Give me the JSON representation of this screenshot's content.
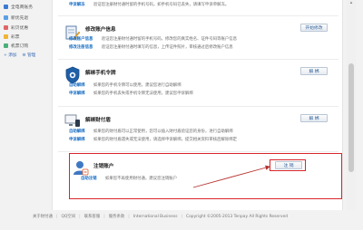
{
  "sidebar": {
    "items": [
      {
        "label": "全电商账务",
        "color": "#3b7bd4"
      },
      {
        "label": "新优先退",
        "color": "#5aa0e6"
      },
      {
        "label": "彩贝优惠",
        "color": "#e06666"
      },
      {
        "label": "彩票",
        "color": "#f2b233"
      },
      {
        "label": "机票订购",
        "color": "#4caf7a"
      }
    ],
    "add_label": "+ 添加",
    "manage_label": "⚙ 管理"
  },
  "sections": [
    {
      "lines": [
        {
          "tag": "申诉解冻",
          "text": "验证您注册财付通时留的手机号码，如手机号码已丢失，请填写申诉单解冻。"
        }
      ]
    },
    {
      "title": "修改账户信息",
      "button": "开始修改",
      "lines": [
        {
          "tag": "修改账户信息",
          "text": "验证您注册财付通时留的手机号码，修改您的真实姓名、证件号码等账户信息"
        },
        {
          "tag": "修改注册信息",
          "text": "验证您注册财付通时填写的信息，上传证件照片，审核通过后修改账户信息"
        }
      ]
    },
    {
      "title": "解绑手机令牌",
      "button": "解 绑",
      "lines": [
        {
          "tag": "自助解绑",
          "text": "如果您的手机令牌可以使用，建议您进行自助解绑"
        },
        {
          "tag": "申诉解绑",
          "text": "如果您的手机丢失或手机令牌无法使用，建议您申诉解绑"
        }
      ]
    },
    {
      "title": "解绑财付盾",
      "button": "解 绑",
      "lines": [
        {
          "tag": "自助解绑",
          "text": "如果您的财付盾可以正常使用，您可以插入财付盾验证您的身份，进行自助解绑"
        },
        {
          "tag": "申诉解绑",
          "text": "如果您的财付盾遗失或无法使用，请选择申诉解绑，提交相关资料审核后解除绑定"
        }
      ]
    },
    {
      "title": "注销账户",
      "button": "注 销",
      "lines": [
        {
          "tag": "自助注销",
          "text": "如果您不再使用财付通，建议您注销账户"
        }
      ]
    }
  ],
  "footer": {
    "links": [
      "关于财付通",
      "QQ空间",
      "联系客服",
      "服务条款",
      "International Business"
    ],
    "copyright": "Copyright ©2005-2013 Tenpay All Rights Reserved"
  },
  "colors": {
    "highlight": "#d8262b",
    "link": "#1a6fc4",
    "arrow": "#b5322e"
  }
}
